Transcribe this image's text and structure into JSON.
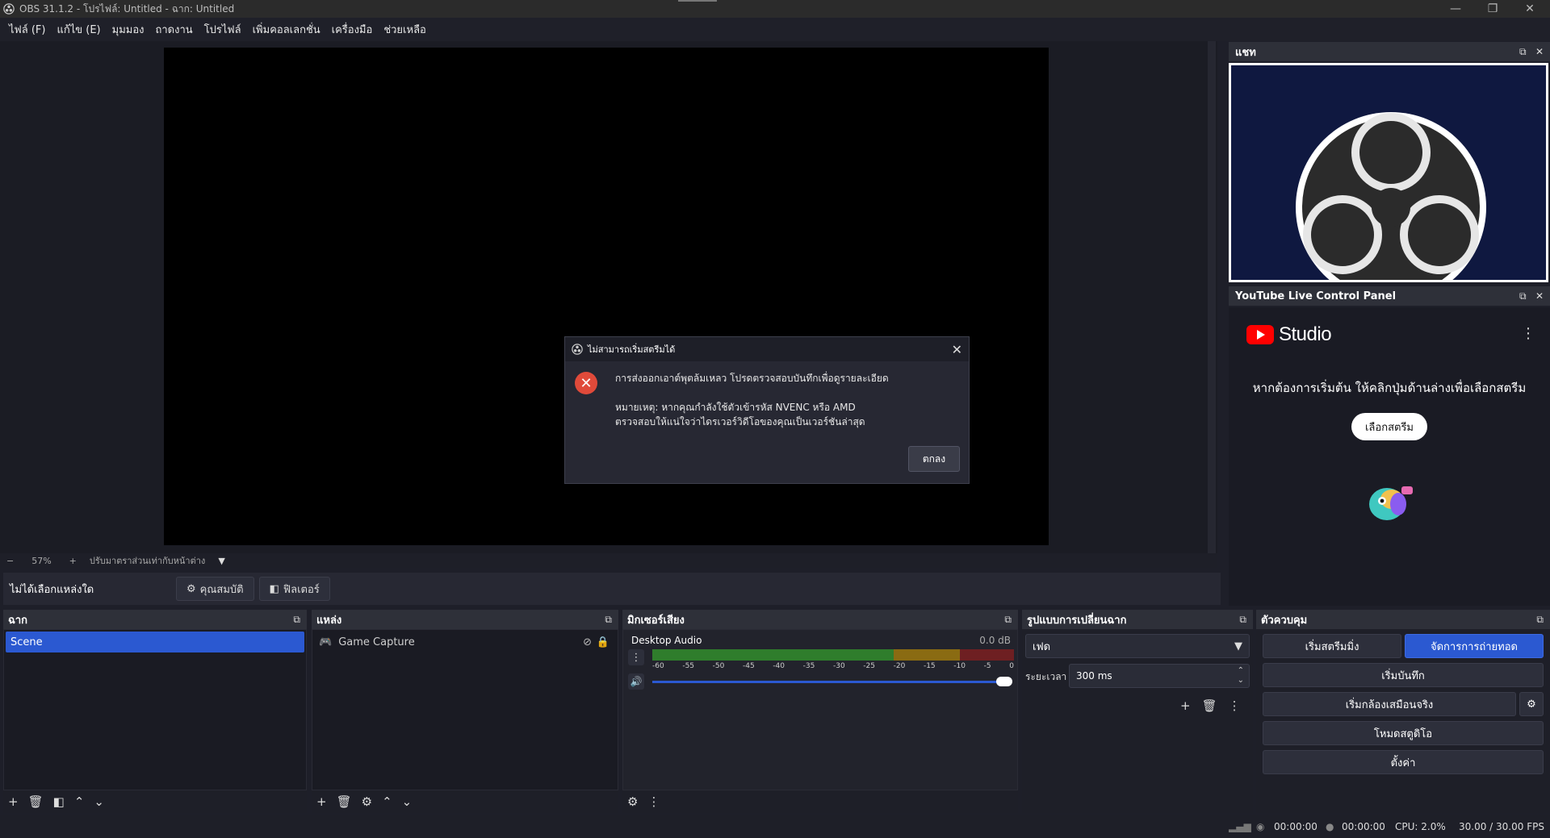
{
  "window": {
    "title": "OBS 31.1.2 - โปรไฟล์: Untitled - ฉาก: Untitled",
    "controls": [
      "minimize-icon",
      "restore-icon",
      "close-icon"
    ]
  },
  "menu": [
    "ไฟล์ (F)",
    "แก้ไข (E)",
    "มุมมอง",
    "ถาดงาน",
    "โปรไฟล์",
    "เพิ่มคอลเลกชั่น",
    "เครื่องมือ",
    "ช่วยเหลือ"
  ],
  "zoom": {
    "minus": "−",
    "value": "57%",
    "plus": "+",
    "fit_label": "ปรับมาตราส่วนเท่ากับหน้าต่าง"
  },
  "source_toolbar": {
    "none_selected": "ไม่ได้เลือกแหล่งใด",
    "properties": "คุณสมบัติ",
    "filters": "ฟิลเตอร์"
  },
  "docks": {
    "chat": {
      "title": "แชท"
    },
    "youtube": {
      "title": "YouTube Live Control Panel",
      "studio_label": "Studio",
      "message": "หากต้องการเริ่มต้น ให้คลิกปุ่มด้านล่างเพื่อเลือกสตรีม",
      "select_stream": "เลือกสตรีม"
    },
    "scenes": {
      "title": "ฉาก",
      "items": [
        "Scene"
      ]
    },
    "sources": {
      "title": "แหล่ง",
      "items": [
        "Game Capture"
      ]
    },
    "mixer": {
      "title": "มิกเซอร์เสียง",
      "channel": "Desktop Audio",
      "level": "0.0 dB",
      "ticks": [
        "-60",
        "-55",
        "-50",
        "-45",
        "-40",
        "-35",
        "-30",
        "-25",
        "-20",
        "-15",
        "-10",
        "-5",
        "0"
      ]
    },
    "transitions": {
      "title": "รูปแบบการเปลี่ยนฉาก",
      "selected": "เฟด",
      "duration_label": "ระยะเวลา",
      "duration_value": "300 ms"
    },
    "controls": {
      "title": "ตัวควบคุม",
      "start_stream": "เริ่มสตรีมมิ่ง",
      "manage_broadcast": "จัดการการถ่ายทอด",
      "start_recording": "เริ่มบันทึก",
      "start_virtualcam": "เริ่มกล้องเสมือนจริง",
      "studio_mode": "โหมดสตูดิโอ",
      "settings": "ตั้งค่า"
    }
  },
  "dialog": {
    "title": "ไม่สามารถเริ่มสตรีมได้",
    "message": "การส่งออกเอาต์พุตล้มเหลว โปรดตรวจสอบบันทึกเพื่อดูรายละเอียด",
    "note_line1": "หมายเหตุ: หากคุณกำลังใช้ตัวเข้ารหัส NVENC หรือ AMD",
    "note_line2": "ตรวจสอบให้แน่ใจว่าไดรเวอร์วิดีโอของคุณเป็นเวอร์ชันล่าสุด",
    "ok": "ตกลง"
  },
  "status": {
    "stream_time": "00:00:00",
    "rec_time": "00:00:00",
    "cpu": "CPU: 2.0%",
    "fps": "30.00 / 30.00 FPS"
  },
  "colors": {
    "accent_blue": "#2b59d1",
    "error_red": "#e04a3a",
    "yt_red": "#ff0000"
  }
}
